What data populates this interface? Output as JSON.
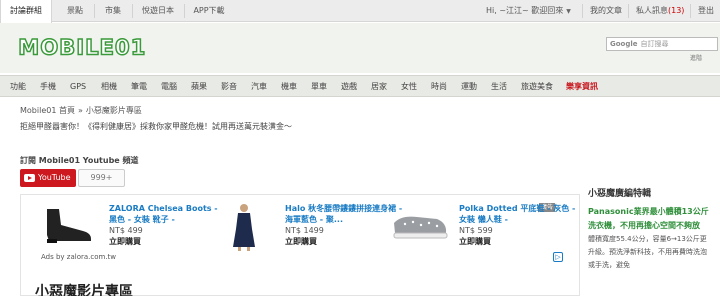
{
  "topbar": {
    "tabs": [
      "討論群組",
      "景點",
      "市集",
      "悅遊日本",
      "APP下載"
    ],
    "greeting": "Hi, ~江江~ 歡迎回來",
    "links": {
      "profile": "我的文章",
      "messages": "私人訊息",
      "messages_count": "(13)",
      "logout": "登出"
    }
  },
  "header": {
    "logo_text": "MOBILE01",
    "search_placeholder": "自訂搜尋",
    "search_brand": "Google",
    "advanced": "進階"
  },
  "nav": {
    "items": [
      "功能",
      "手機",
      "GPS",
      "相機",
      "筆電",
      "電腦",
      "蘋果",
      "影音",
      "汽車",
      "機車",
      "單車",
      "遊戲",
      "居家",
      "女性",
      "時尚",
      "運動",
      "生活",
      "旅遊美食"
    ],
    "hot": "樂享資訊"
  },
  "breadcrumb": {
    "home": "Mobile01 首頁",
    "arrow": "»",
    "current": "小惡魔影片專區"
  },
  "promo": "拒絕甲醛囂害你！《得利健康居》採救你家甲醛危機！試用再送萬元裝潢金～",
  "subscribe": {
    "title": "訂閱 Mobile01 Youtube 頻道",
    "button": "YouTube",
    "count": "999+"
  },
  "ads": {
    "label": "廣告",
    "items": [
      {
        "title": "ZALORA Chelsea Boots - 黑色 - 女裝 靴子 -",
        "price": "NT$ 499",
        "buy": "立即購買"
      },
      {
        "title": "Halo 秋冬腰帶鏤鏤拼接連身裙 - 海軍藍色 - 聚...",
        "price": "NT$ 1499",
        "buy": "立即購買"
      },
      {
        "title": "Polka Dotted 平底鞋 - 灰色 - 女裝 懶人鞋 -",
        "price": "NT$ 599",
        "buy": "立即購買"
      }
    ],
    "adsby": "Ads by zalora.com.tw"
  },
  "page_title": "小惡魔影片專區",
  "sidebar": {
    "heading": "小惡魔廣編特輯",
    "article_title": "Panasonic業界最小體積13公斤洗衣機，不用再擔心空間不夠放",
    "article_desc": "體積寬度55.4公分，容量6→13公斤更升級。預洗淨新科技，不用再費時洗泡或手洗，避免"
  },
  "colors": {
    "accent": "#2f8f3a",
    "brand_red": "#c8161d",
    "link": "#1a7cc4",
    "youtube": "#cc181e"
  }
}
